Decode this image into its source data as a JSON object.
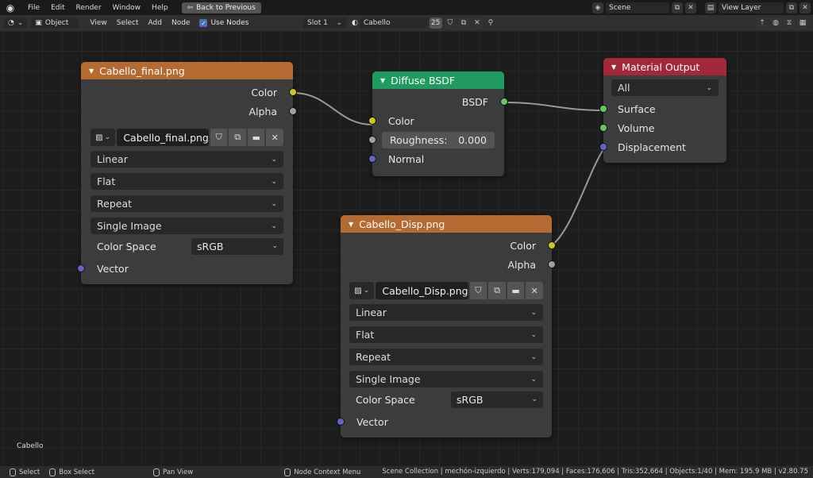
{
  "topbar": {
    "menus": [
      "File",
      "Edit",
      "Render",
      "Window",
      "Help"
    ],
    "back_button": "Back to Previous",
    "scene": "Scene",
    "view_layer": "View Layer"
  },
  "header": {
    "mode": "Object",
    "menus": [
      "View",
      "Select",
      "Add",
      "Node"
    ],
    "use_nodes_label": "Use Nodes",
    "slot": "Slot 1",
    "material_name": "Cabello",
    "user_count": "25"
  },
  "nodes": {
    "image1": {
      "title": "Cabello_final.png",
      "out_color": "Color",
      "out_alpha": "Alpha",
      "image_name": "Cabello_final.png",
      "interpolation": "Linear",
      "projection": "Flat",
      "extension": "Repeat",
      "source": "Single Image",
      "color_space_label": "Color Space",
      "color_space": "sRGB",
      "in_vector": "Vector"
    },
    "diffuse": {
      "title": "Diffuse BSDF",
      "out_bsdf": "BSDF",
      "in_color": "Color",
      "roughness_label": "Roughness:",
      "roughness_value": "0.000",
      "in_normal": "Normal"
    },
    "output": {
      "title": "Material Output",
      "target": "All",
      "in_surface": "Surface",
      "in_volume": "Volume",
      "in_displacement": "Displacement"
    },
    "image2": {
      "title": "Cabello_Disp.png",
      "out_color": "Color",
      "out_alpha": "Alpha",
      "image_name": "Cabello_Disp.png",
      "interpolation": "Linear",
      "projection": "Flat",
      "extension": "Repeat",
      "source": "Single Image",
      "color_space_label": "Color Space",
      "color_space": "sRGB",
      "in_vector": "Vector"
    }
  },
  "canvas_label": "Cabello",
  "status": {
    "hint_select": "Select",
    "hint_box": "Box Select",
    "hint_pan": "Pan View",
    "hint_menu": "Node Context Menu",
    "stats": "Scene Collection | mechón-izquierdo | Verts:179,094 | Faces:176,606 | Tris:352,664 | Objects:1/40 | Mem: 195.9 MB | v2.80.75"
  },
  "colors": {
    "image_header": "#b56a31",
    "shader_header": "#1f9b60",
    "output_header": "#a3283a",
    "socket_color": "#c7c729",
    "socket_shader": "#63c763",
    "socket_vector": "#6363c7",
    "socket_float": "#a1a1a1"
  }
}
